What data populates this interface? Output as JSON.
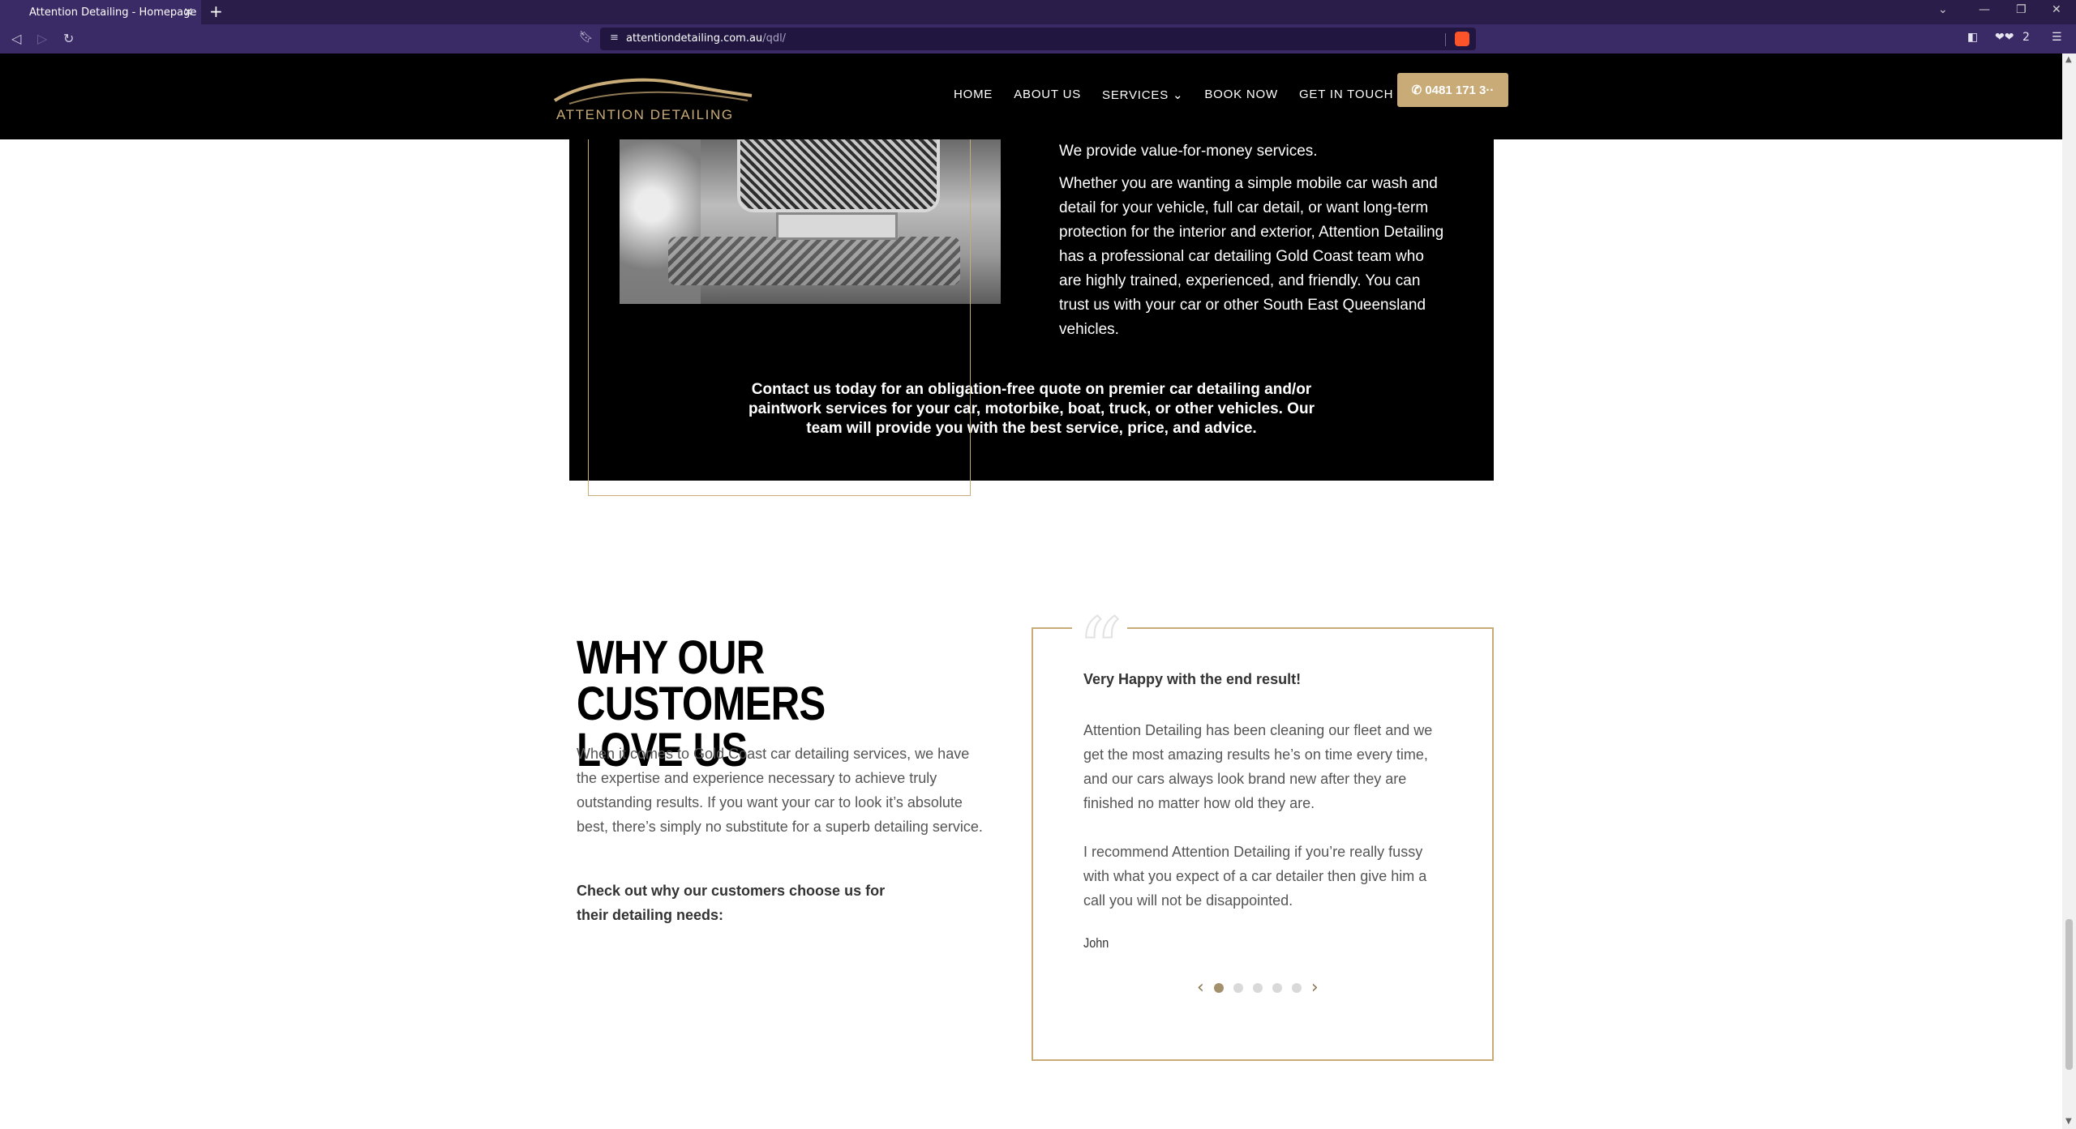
{
  "browser": {
    "tab_title": "Attention Detailing - Homepage",
    "tab_close": "✕",
    "new_tab": "+",
    "url_host": "attentiondetailing.com.au",
    "url_path": "/qdl/",
    "extension_count": "2"
  },
  "header": {
    "logo_text": "ATTENTION DETAILING",
    "nav": {
      "home": "HOME",
      "about": "ABOUT US",
      "services": "SERVICES",
      "book": "BOOK NOW",
      "contact": "GET IN TOUCH"
    },
    "phone_label": "0481 171 3··"
  },
  "dark_section": {
    "value_line": "We provide value-for-money services.",
    "main_paragraph": "Whether you are wanting a simple mobile car wash and detail for your vehicle, full car detail, or want long-term protection for the interior and exterior, Attention Detailing has a professional car detailing Gold Coast team who are highly trained, experienced, and friendly. You can trust us with your car or other South East Queensland vehicles.",
    "contact_cta": "Contact us today for an obligation-free quote on premier car detailing and/or paintwork services for your car, motorbike, boat, truck, or other vehicles. Our team will provide you with the best service, price, and advice."
  },
  "why_section": {
    "title_line1": "WHY OUR",
    "title_line2": "CUSTOMERS LOVE US",
    "text": "When it comes to Gold Coast car detailing services, we have the expertise and experience necessary to achieve truly outstanding results. If you want your car to look it’s absolute best, there’s simply no substitute for a superb detailing service.",
    "cta": "Check out why our customers choose us for their detailing needs:"
  },
  "testimonial": {
    "quote_glyph": "“",
    "headline": "Very Happy with the end result!",
    "body1": "Attention Detailing has been cleaning our fleet and we get the most amazing results he’s on time every time, and our cars always look brand new after they are finished no matter how old they are.",
    "body2": "I recommend Attention Detailing if you’re really fussy with what you expect of a car detailer then give him a call you will not be disappointed.",
    "author": "John",
    "prev": "‹",
    "next": "›",
    "slide_count": 5,
    "active_slide": 1
  },
  "colors": {
    "gold_accent": "#c8ab77",
    "chrome_purple": "#3a2a66"
  }
}
